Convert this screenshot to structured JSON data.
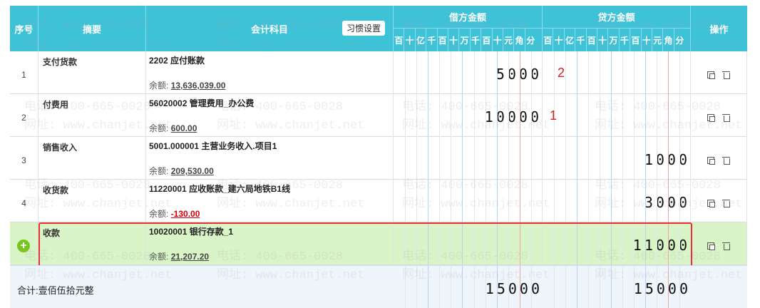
{
  "header": {
    "col_index": "序号",
    "col_summary": "摘要",
    "col_account": "会计科目",
    "habit_button": "习惯设置",
    "debit_title": "借方金额",
    "credit_title": "贷方金额",
    "ops_title": "操作",
    "digits": [
      "百",
      "十",
      "亿",
      "千",
      "百",
      "十",
      "万",
      "千",
      "百",
      "十",
      "元",
      "角",
      "分"
    ]
  },
  "rows": [
    {
      "index": "1",
      "summary": "支付货款",
      "account": "2202 应付账款",
      "balance_label": "余额:",
      "balance": "13,636,039.00",
      "debit": "5000",
      "credit": "",
      "note": "2"
    },
    {
      "index": "2",
      "summary": "付费用",
      "account": "56020002 管理费用_办公费",
      "balance_label": "余额:",
      "balance": "600.00",
      "debit": "10000",
      "credit": "",
      "note": "1"
    },
    {
      "index": "3",
      "summary": "销售收入",
      "account": "5001.000001 主营业务收入.项目1",
      "balance_label": "余额:",
      "balance": "209,530.00",
      "debit": "",
      "credit": "1000",
      "note": ""
    },
    {
      "index": "4",
      "summary": "收货款",
      "account": "11220001 应收账款_建六局地铁B1线",
      "balance_label": "余额:",
      "balance": "-130.00",
      "debit": "",
      "credit": "3000",
      "note": ""
    },
    {
      "index": "",
      "summary": "收款",
      "account": "10020001 银行存款_1",
      "balance_label": "余额:",
      "balance": "21,207.20",
      "debit": "",
      "credit": "11000",
      "note": ""
    }
  ],
  "total": {
    "label": "合计:壹佰伍拾元整",
    "debit": "15000",
    "credit": "15000"
  },
  "watermark": {
    "phone": "电话: 400-665-0028",
    "site": "网址: www.chanjet.net"
  },
  "colors": {
    "header": "#3ec2d8",
    "selected_row": "#d9f5c7",
    "highlight_border": "#e43333",
    "annotation": "#d62020"
  }
}
